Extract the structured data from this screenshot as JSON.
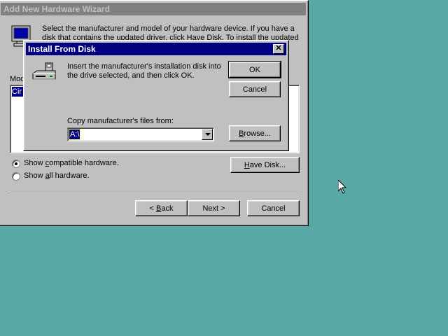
{
  "wizard": {
    "title": "Add New Hardware Wizard",
    "instructions": "Select the manufacturer and model of your hardware device. If you have a disk that contains the updated driver, click Have Disk. To install the updated",
    "models_label_fragment": "Mod",
    "list_item_fragment": "Cir",
    "radio_compatible": {
      "pre": "Show ",
      "key": "c",
      "post": "ompatible hardware."
    },
    "radio_all": {
      "pre": "Show ",
      "key": "a",
      "post": "ll hardware."
    },
    "have_disk": {
      "key": "H",
      "post": "ave Disk..."
    },
    "back": {
      "pre": "< ",
      "key": "B",
      "post": "ack"
    },
    "next_label": "Next >",
    "cancel_label": "Cancel"
  },
  "dialog": {
    "title": "Install From Disk",
    "close_glyph": "✕",
    "message_line1": "Insert the manufacturer's installation disk into",
    "message_line2": "the drive selected, and then click OK.",
    "ok_label": "OK",
    "cancel_label": "Cancel",
    "copy_label": "Copy manufacturer's files from:",
    "path_value": "A:\\",
    "browse": {
      "key": "B",
      "post": "rowse..."
    }
  },
  "colors": {
    "desktop": "#58a8a8",
    "active_title": "#000080",
    "inactive_title": "#808080",
    "face": "#c0c0c0"
  },
  "icons": [
    "monitor-icon",
    "disk-drive-icon",
    "mouse-pointer-icon",
    "dropdown-arrow-icon",
    "close-icon"
  ]
}
